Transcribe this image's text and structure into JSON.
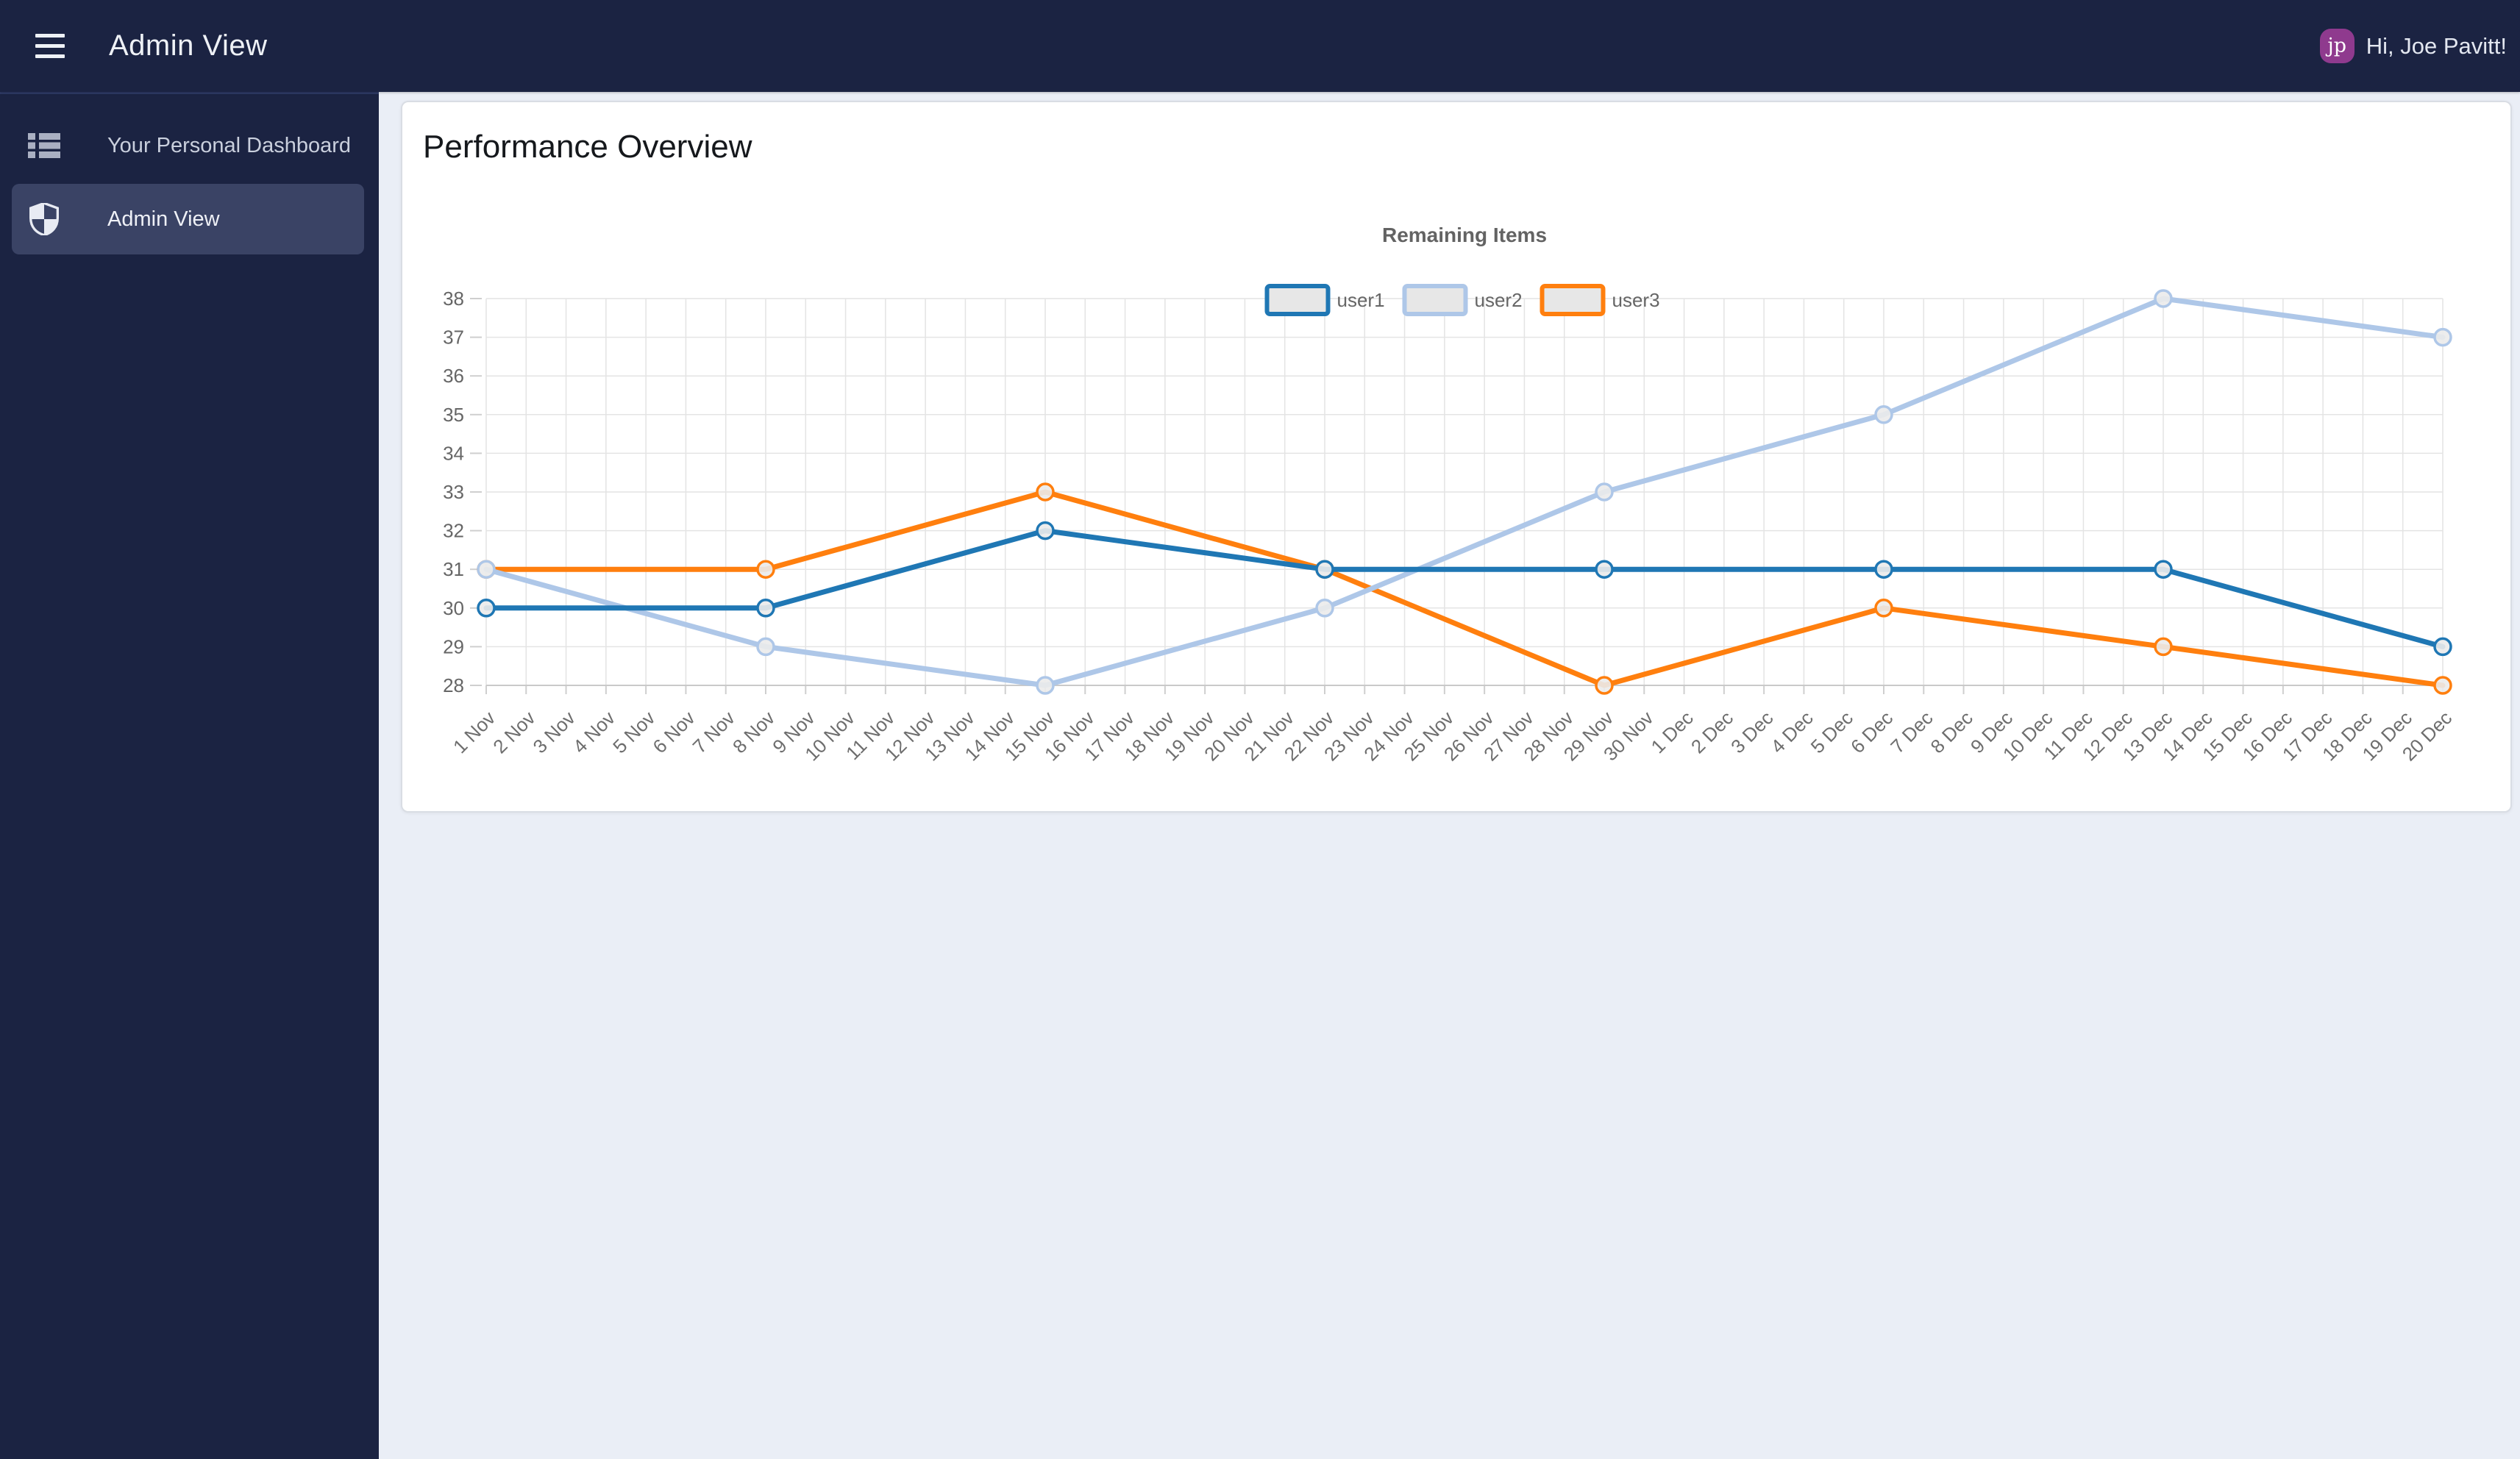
{
  "header": {
    "title": "Admin View",
    "greeting": "Hi, Joe Pavitt!",
    "avatar_initials": "jp",
    "colors": {
      "bar": "#1b2342",
      "avatar": "#8f3a8e"
    }
  },
  "sidebar": {
    "items": [
      {
        "label": "Your Personal Dashboard",
        "icon": "dashboard-list-icon",
        "active": false
      },
      {
        "label": "Admin View",
        "icon": "shield-icon",
        "active": true
      }
    ]
  },
  "main": {
    "card_title": "Performance Overview"
  },
  "chart_data": {
    "type": "line",
    "title": "Remaining Items",
    "legend_position": "top",
    "grid": true,
    "ylim": [
      28,
      38
    ],
    "y_ticks": [
      28,
      29,
      30,
      31,
      32,
      33,
      34,
      35,
      36,
      37,
      38
    ],
    "x_labels": [
      "1 Nov",
      "2 Nov",
      "3 Nov",
      "4 Nov",
      "5 Nov",
      "6 Nov",
      "7 Nov",
      "8 Nov",
      "9 Nov",
      "10 Nov",
      "11 Nov",
      "12 Nov",
      "13 Nov",
      "14 Nov",
      "15 Nov",
      "16 Nov",
      "17 Nov",
      "18 Nov",
      "19 Nov",
      "20 Nov",
      "21 Nov",
      "22 Nov",
      "23 Nov",
      "24 Nov",
      "25 Nov",
      "26 Nov",
      "27 Nov",
      "28 Nov",
      "29 Nov",
      "30 Nov",
      "1 Dec",
      "2 Dec",
      "3 Dec",
      "4 Dec",
      "5 Dec",
      "6 Dec",
      "7 Dec",
      "8 Dec",
      "9 Dec",
      "10 Dec",
      "11 Dec",
      "12 Dec",
      "13 Dec",
      "14 Dec",
      "15 Dec",
      "16 Dec",
      "17 Dec",
      "18 Dec",
      "19 Dec",
      "20 Dec"
    ],
    "point_dates": [
      "1 Nov",
      "8 Nov",
      "15 Nov",
      "22 Nov",
      "29 Nov",
      "6 Dec",
      "13 Dec",
      "20 Dec"
    ],
    "series": [
      {
        "name": "user1",
        "color": "#1f77b4",
        "values": [
          30,
          30,
          32,
          31,
          31,
          31,
          31,
          29
        ]
      },
      {
        "name": "user2",
        "color": "#aec7e8",
        "values": [
          31,
          29,
          28,
          30,
          33,
          35,
          38,
          37
        ]
      },
      {
        "name": "user3",
        "color": "#ff7f0e",
        "values": [
          31,
          31,
          33,
          31,
          28,
          30,
          29,
          28
        ]
      }
    ]
  }
}
